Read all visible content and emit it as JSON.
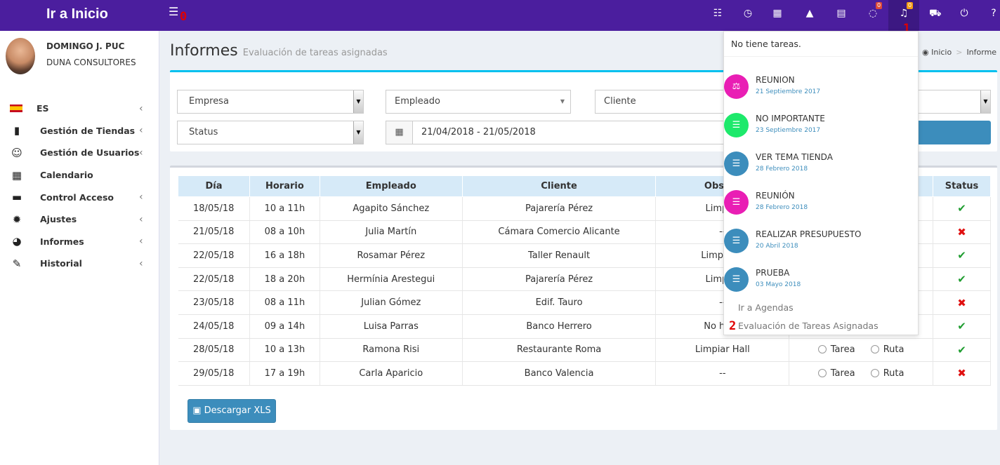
{
  "topbar": {
    "brand": "Ir a Inicio",
    "menu_marker": "0",
    "icons": [
      "list-icon",
      "clock-icon",
      "calendar-check-icon",
      "road-icon",
      "newspaper-icon",
      "comments-icon",
      "bell-icon",
      "cart-icon",
      "power-icon",
      "question-icon"
    ],
    "comments_badge": "0",
    "bell_badge": "0",
    "bell_marker": "1"
  },
  "user": {
    "name": "DOMINGO J. PUC",
    "company": "DUNA CONSULTORES"
  },
  "sidebar": {
    "items": [
      {
        "label": "ES",
        "icon": "spain-flag-icon"
      },
      {
        "label": "Gestión de Tiendas",
        "icon": "building-icon"
      },
      {
        "label": "Gestión de Usuarios",
        "icon": "smile-icon"
      },
      {
        "label": "Calendario",
        "icon": "calendar-icon"
      },
      {
        "label": "Control Acceso",
        "icon": "credit-card-icon"
      },
      {
        "label": "Ajustes",
        "icon": "gear-icon"
      },
      {
        "label": "Informes",
        "icon": "pie-chart-icon"
      },
      {
        "label": "Historial",
        "icon": "edit-icon"
      }
    ]
  },
  "page": {
    "title": "Informes",
    "subtitle": "Evaluación de tareas asignadas"
  },
  "breadcrumb": {
    "home": "Inicio",
    "current": "Informe"
  },
  "filters": {
    "empresa": "Empresa",
    "empleado": "Empleado",
    "cliente": "Cliente",
    "status": "Status",
    "date_range": "21/04/2018 - 21/05/2018"
  },
  "table": {
    "headers": [
      "Día",
      "Horario",
      "Empleado",
      "Cliente",
      "Observ",
      "",
      "Status"
    ],
    "rows": [
      {
        "dia": "18/05/18",
        "horario": "10 a 11h",
        "empleado": "Agapito Sánchez",
        "cliente": "Pajarería Pérez",
        "obs": "Limpiar",
        "status": "✔"
      },
      {
        "dia": "21/05/18",
        "horario": "08 a 10h",
        "empleado": "Julia Martín",
        "cliente": "Cámara Comercio Alicante",
        "obs": "--",
        "status": "✖"
      },
      {
        "dia": "22/05/18",
        "horario": "16 a 18h",
        "empleado": "Rosamar Pérez",
        "cliente": "Taller Renault",
        "obs": "Limpiar p",
        "status": "✔"
      },
      {
        "dia": "22/05/18",
        "horario": "18 a 20h",
        "empleado": "Hermínia Arestegui",
        "cliente": "Pajarería Pérez",
        "obs": "Limpiar",
        "status": "✔"
      },
      {
        "dia": "23/05/18",
        "horario": "08 a 11h",
        "empleado": "Julian Gómez",
        "cliente": "Edif. Tauro",
        "obs": "--",
        "status": "✖"
      },
      {
        "dia": "24/05/18",
        "horario": "09 a 14h",
        "empleado": "Luisa Parras",
        "cliente": "Banco Herrero",
        "obs": "No hace",
        "status": "✔"
      },
      {
        "dia": "28/05/18",
        "horario": "10 a 13h",
        "empleado": "Ramona Risi",
        "cliente": "Restaurante Roma",
        "obs": "Limpiar Hall",
        "tarea": "Tarea",
        "ruta": "Ruta",
        "status": "✔"
      },
      {
        "dia": "29/05/18",
        "horario": "17 a 19h",
        "empleado": "Carla Aparicio",
        "cliente": "Banco Valencia",
        "obs": "--",
        "tarea": "Tarea",
        "ruta": "Ruta",
        "status": "✖"
      }
    ]
  },
  "download_button": "Descargar XLS",
  "dropdown": {
    "header": "No tiene tareas.",
    "items": [
      {
        "title": "REUNION",
        "date": "21 Septiembre 2017",
        "color": "#e91eb4",
        "icon": "balance-scale-icon"
      },
      {
        "title": "NO IMPORTANTE",
        "date": "23 Septiembre 2017",
        "color": "#1de96b",
        "icon": "list-icon"
      },
      {
        "title": "VER TEMA TIENDA",
        "date": "28 Febrero 2018",
        "color": "#3c8dbc",
        "icon": "list-icon"
      },
      {
        "title": "REUNIÓN",
        "date": "28 Febrero 2018",
        "color": "#e91eb4",
        "icon": "list-icon"
      },
      {
        "title": "REALIZAR PRESUPUESTO",
        "date": "20 Abril 2018",
        "color": "#3c8dbc",
        "icon": "list-icon"
      },
      {
        "title": "PRUEBA",
        "date": "03 Mayo 2018",
        "color": "#3c8dbc",
        "icon": "list-icon"
      }
    ],
    "link_agendas": "Ir a Agendas",
    "link_evaluacion": "Evaluación de Tareas Asignadas",
    "link_marker": "2"
  }
}
